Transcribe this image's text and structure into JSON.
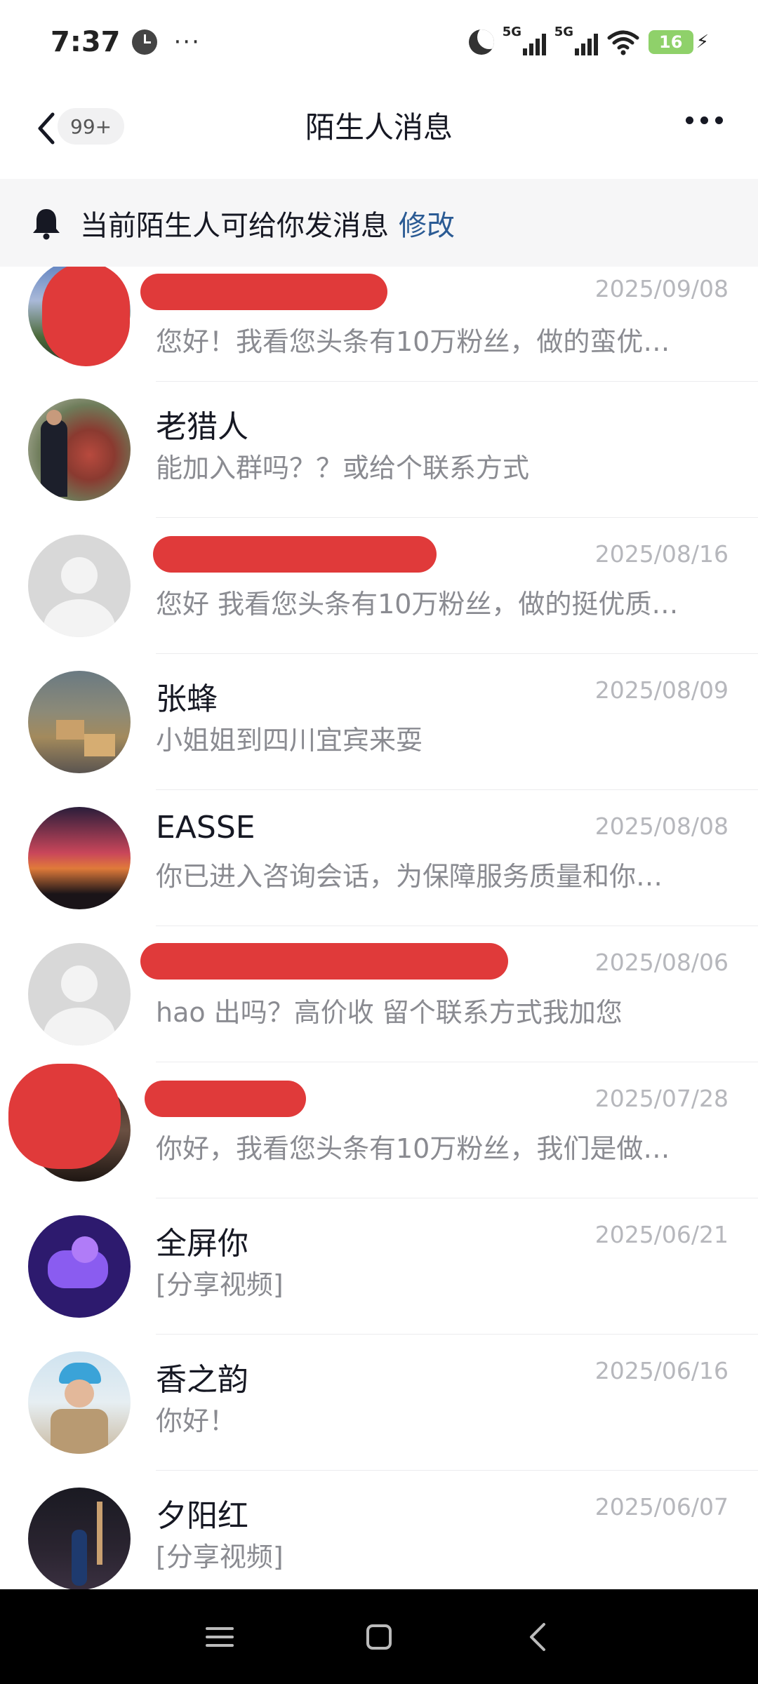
{
  "status_bar": {
    "time": "7:37",
    "dots": "···",
    "signal1_tag": "5G",
    "signal2_tag": "5G",
    "battery": "16",
    "icons": [
      "clock-icon",
      "moon-icon",
      "signal-icon",
      "wifi-icon",
      "battery-icon",
      "charging-icon"
    ]
  },
  "header": {
    "title": "陌生人消息",
    "unread_badge": "99+",
    "back_icon": "chevron-left-icon",
    "more_icon": "more-horizontal-icon"
  },
  "notice": {
    "text": "当前陌生人可给你发消息",
    "link": "修改",
    "icon": "bell-icon"
  },
  "colors": {
    "link": "#2b5b94",
    "redaction": "#e03a3a",
    "time": "#b6b7bc",
    "preview": "#8a8b91"
  },
  "messages": [
    {
      "name": "",
      "time": "2025/09/08",
      "preview": "您好！我看您头条有10万粉丝，做的蛮优…",
      "redacted": true
    },
    {
      "name": "老猎人",
      "time": "",
      "preview": "能加入群吗？？或给个联系方式",
      "redacted": false
    },
    {
      "name": "",
      "time": "2025/08/16",
      "preview": "您好  我看您头条有10万粉丝，做的挺优质…",
      "redacted": true
    },
    {
      "name": "张蜂",
      "time": "2025/08/09",
      "preview": "小姐姐到四川宜宾来耍",
      "redacted": false
    },
    {
      "name": "EASSE",
      "time": "2025/08/08",
      "preview": "你已进入咨询会话，为保障服务质量和你…",
      "redacted": false
    },
    {
      "name": "",
      "time": "2025/08/06",
      "preview": "hao 出吗？高价收 留个联系方式我加您",
      "redacted": true
    },
    {
      "name": "",
      "time": "2025/07/28",
      "preview": "你好，我看您头条有10万粉丝，我们是做…",
      "redacted": true
    },
    {
      "name": "全屏你",
      "time": "2025/06/21",
      "preview": "[分享视频]",
      "redacted": false
    },
    {
      "name": "香之韵",
      "time": "2025/06/16",
      "preview": "你好！",
      "redacted": false
    },
    {
      "name": "夕阳红",
      "time": "2025/06/07",
      "preview": "[分享视频]",
      "redacted": false
    }
  ],
  "nav": {
    "icons": [
      "menu-icon",
      "home-square-icon",
      "back-triangle-icon"
    ]
  }
}
